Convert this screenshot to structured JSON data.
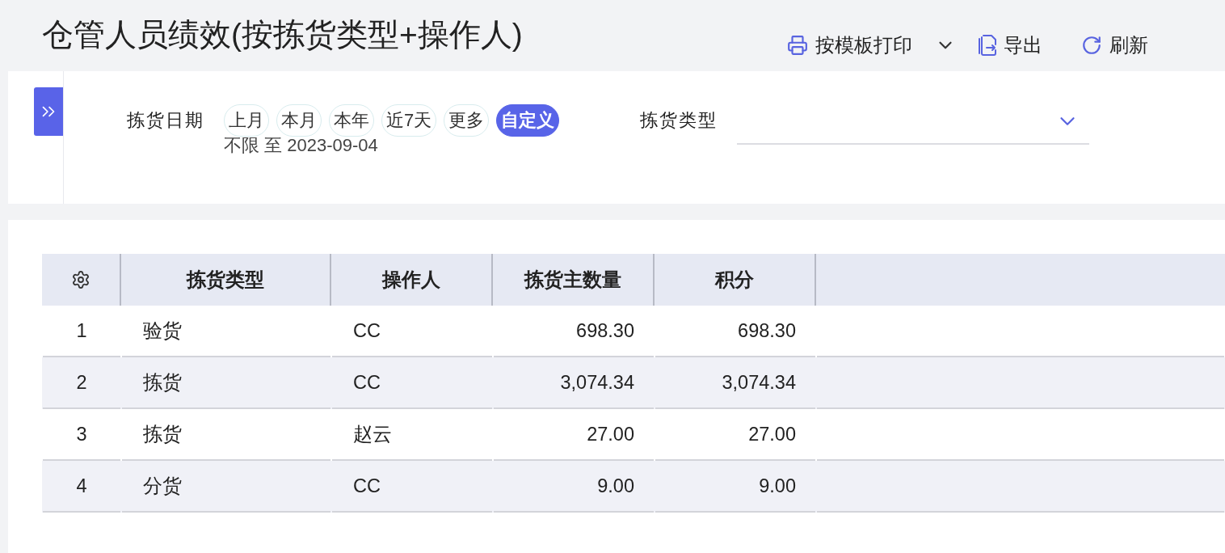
{
  "page": {
    "title": "仓管人员绩效(按拣货类型+操作人)"
  },
  "toolbar": [
    {
      "kind": "print",
      "label": "按模板打印",
      "dropdown": true
    },
    {
      "kind": "export",
      "label": "导出",
      "dropdown": false
    },
    {
      "kind": "refresh",
      "label": "刷新",
      "dropdown": false
    }
  ],
  "filters": {
    "date": {
      "label": "拣货日期",
      "presets": [
        {
          "label": "上月",
          "selected": false
        },
        {
          "label": "本月",
          "selected": false
        },
        {
          "label": "本年",
          "selected": false
        },
        {
          "label": "近7天",
          "selected": false
        },
        {
          "label": "更多",
          "selected": false
        },
        {
          "label": "自定义",
          "selected": true
        }
      ],
      "range": "不限 至 2023-09-04"
    },
    "picking_type": {
      "label": "拣货类型"
    }
  },
  "table": {
    "columns": [
      {
        "label": "拣货类型",
        "kind": "text"
      },
      {
        "label": "操作人",
        "kind": "text"
      },
      {
        "label": "拣货主数量",
        "kind": "number"
      },
      {
        "label": "积分",
        "kind": "number"
      }
    ],
    "rows": [
      {
        "index": "1",
        "cells": [
          "验货",
          "CC",
          "698.30",
          "698.30"
        ]
      },
      {
        "index": "2",
        "cells": [
          "拣货",
          "CC",
          "3,074.34",
          "3,074.34"
        ]
      },
      {
        "index": "3",
        "cells": [
          "拣货",
          "赵云",
          "27.00",
          "27.00"
        ]
      },
      {
        "index": "4",
        "cells": [
          "分货",
          "CC",
          "9.00",
          "9.00"
        ]
      }
    ]
  }
}
